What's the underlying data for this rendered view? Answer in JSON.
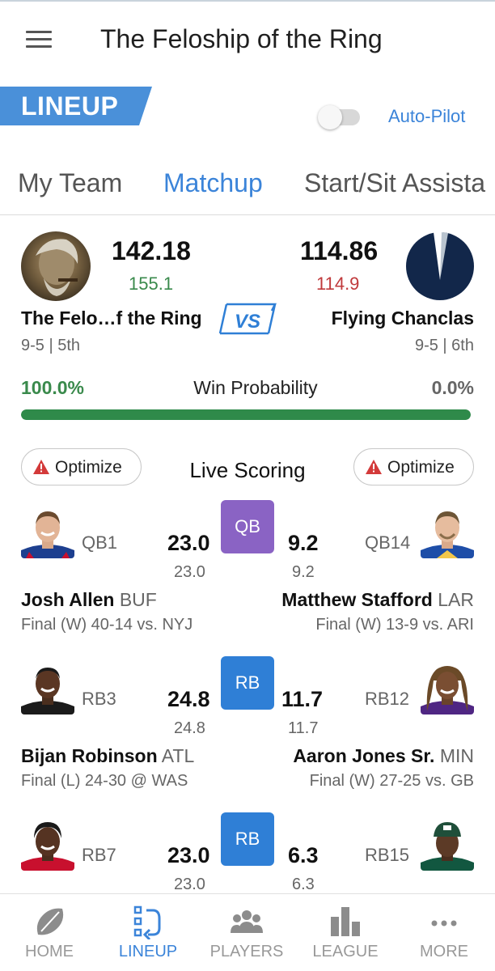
{
  "header": {
    "title": "The Feloship of the Ring",
    "menu_icon": "hamburger-menu-icon"
  },
  "section": {
    "label": "LINEUP",
    "autopilot_label": "Auto-Pilot",
    "autopilot_on": false
  },
  "tabs": [
    {
      "label": "My Team",
      "active": false
    },
    {
      "label": "Matchup",
      "active": true
    },
    {
      "label": "Start/Sit Assista",
      "active": false
    }
  ],
  "matchup": {
    "vs_label": "VS",
    "home": {
      "score": "142.18",
      "projected": "155.1",
      "name": "The Felo…f the Ring",
      "record": "9-5 | 5th",
      "win_prob": "100.0%"
    },
    "away": {
      "score": "114.86",
      "projected": "114.9",
      "name": "Flying Chanclas",
      "record": "9-5 | 6th",
      "win_prob": "0.0%"
    },
    "win_prob_label": "Win Probability",
    "win_prob_fraction": 1.0,
    "colors": {
      "positive": "#3a8a4c",
      "negative": "#c0393b",
      "accent": "#3b84d9"
    }
  },
  "live": {
    "title": "Live Scoring",
    "optimize_label": "Optimize",
    "rows": [
      {
        "pos": "QB",
        "pos_color": "#8a63c4",
        "left": {
          "rank": "QB1",
          "points": "23.0",
          "proj": "23.0",
          "name": "Josh Allen",
          "team": "BUF",
          "status": "Final (W) 40-14 vs. NYJ"
        },
        "right": {
          "rank": "QB14",
          "points": "9.2",
          "proj": "9.2",
          "name": "Matthew Stafford",
          "team": "LAR",
          "status": "Final (W) 13-9 vs. ARI"
        }
      },
      {
        "pos": "RB",
        "pos_color": "#2f7fd6",
        "left": {
          "rank": "RB3",
          "points": "24.8",
          "proj": "24.8",
          "name": "Bijan Robinson",
          "team": "ATL",
          "status": "Final (L) 24-30 @ WAS"
        },
        "right": {
          "rank": "RB12",
          "points": "11.7",
          "proj": "11.7",
          "name": "Aaron Jones Sr.",
          "team": "MIN",
          "status": "Final (W) 27-25 vs. GB"
        }
      },
      {
        "pos": "RB",
        "pos_color": "#2f7fd6",
        "left": {
          "rank": "RB7",
          "points": "23.0",
          "proj": "23.0"
        },
        "right": {
          "rank": "RB15",
          "points": "6.3",
          "proj": "6.3"
        }
      }
    ]
  },
  "bottom_nav": [
    {
      "label": "HOME",
      "icon": "football-icon",
      "active": false
    },
    {
      "label": "LINEUP",
      "icon": "lineup-swap-icon",
      "active": true
    },
    {
      "label": "PLAYERS",
      "icon": "players-group-icon",
      "active": false
    },
    {
      "label": "LEAGUE",
      "icon": "league-bars-icon",
      "active": false
    },
    {
      "label": "MORE",
      "icon": "more-dots-icon",
      "active": false
    }
  ]
}
